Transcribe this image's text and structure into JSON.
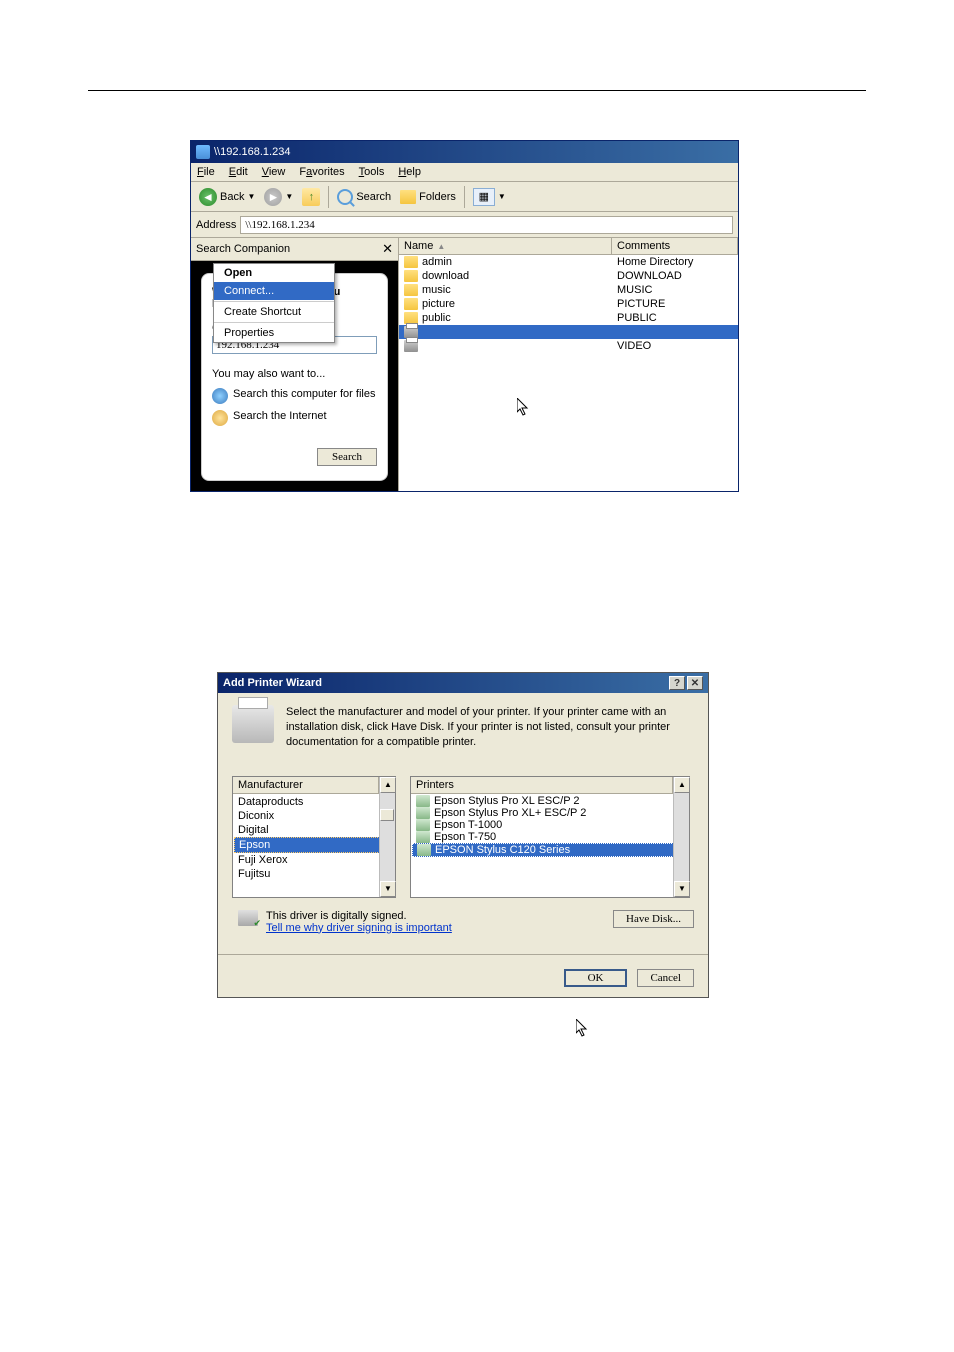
{
  "explorer": {
    "title": "\\\\192.168.1.234",
    "menu": {
      "file": "File",
      "edit": "Edit",
      "view": "View",
      "favorites": "Favorites",
      "tools": "Tools",
      "help": "Help"
    },
    "toolbar": {
      "back": "Back",
      "search": "Search",
      "folders": "Folders"
    },
    "address": {
      "label": "Address",
      "value": "\\\\192.168.1.234"
    },
    "searchpane": {
      "title": "Search Companion",
      "heading": "Which computer are you looking for?",
      "fieldLabel": "Computer name:",
      "fieldValue": "192.168.1.234",
      "also": "You may also want to...",
      "link1": "Search this computer for files",
      "link2": "Search the Internet",
      "button": "Search"
    },
    "columns": {
      "name": "Name",
      "comments": "Comments"
    },
    "rows": [
      {
        "name": "admin",
        "comment": "Home Directory",
        "type": "folder"
      },
      {
        "name": "download",
        "comment": "DOWNLOAD",
        "type": "folder"
      },
      {
        "name": "music",
        "comment": "MUSIC",
        "type": "folder"
      },
      {
        "name": "picture",
        "comment": "PICTURE",
        "type": "folder"
      },
      {
        "name": "public",
        "comment": "PUBLIC",
        "type": "folder"
      },
      {
        "name": "",
        "comment": "",
        "type": "printer"
      },
      {
        "name": "",
        "comment": "VIDEO",
        "type": "printer"
      }
    ],
    "contextMenu": {
      "open": "Open",
      "connect": "Connect...",
      "createShortcut": "Create Shortcut",
      "properties": "Properties"
    }
  },
  "wizard": {
    "title": "Add Printer Wizard",
    "desc": "Select the manufacturer and model of your printer. If your printer came with an installation disk, click Have Disk. If your printer is not listed, consult your printer documentation for a compatible printer.",
    "mfrLabel": "Manufacturer",
    "prnLabel": "Printers",
    "manufacturers": [
      "Dataproducts",
      "Diconix",
      "Digital",
      "Epson",
      "Fuji Xerox",
      "Fujitsu"
    ],
    "printers": [
      "Epson Stylus Pro XL ESC/P 2",
      "Epson Stylus Pro XL+ ESC/P 2",
      "Epson T-1000",
      "Epson T-750",
      "EPSON Stylus C120 Series"
    ],
    "signed": "This driver is digitally signed.",
    "signLink": "Tell me why driver signing is important",
    "haveDisk": "Have Disk...",
    "ok": "OK",
    "cancel": "Cancel"
  }
}
